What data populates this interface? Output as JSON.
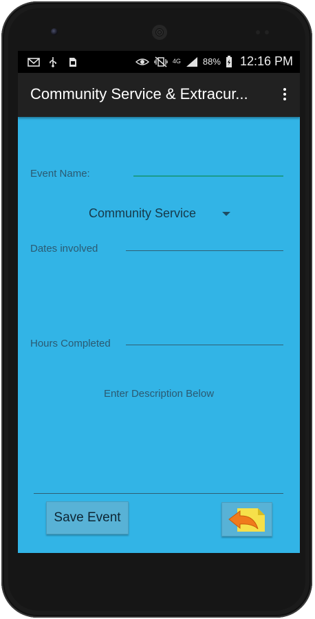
{
  "status_bar": {
    "battery_percent": "88%",
    "time": "12:16 PM",
    "network_label": "4G",
    "left_icons": [
      "mail-icon",
      "usb-icon",
      "sim-icon"
    ],
    "right_icons": [
      "eye-icon",
      "vibrate-icon",
      "4g-icon",
      "signal-icon",
      "battery-icon"
    ]
  },
  "action_bar": {
    "title": "Community Service & Extracur...",
    "overflow_icon": "overflow-menu-icon"
  },
  "form": {
    "event_name_label": "Event Name:",
    "event_name_value": "",
    "category_selected": "Community Service",
    "dates_label": "Dates involved",
    "dates_value": "",
    "hours_label": "Hours Completed",
    "hours_value": "",
    "description_hint": "Enter Description Below",
    "description_value": ""
  },
  "buttons": {
    "save_label": "Save Event",
    "back_icon": "back-arrow-icon"
  },
  "colors": {
    "screen_bg": "#32b4e6",
    "action_bar": "#212121",
    "focus_underline": "#1a9c8c",
    "button_bg": "#58b2d6"
  }
}
